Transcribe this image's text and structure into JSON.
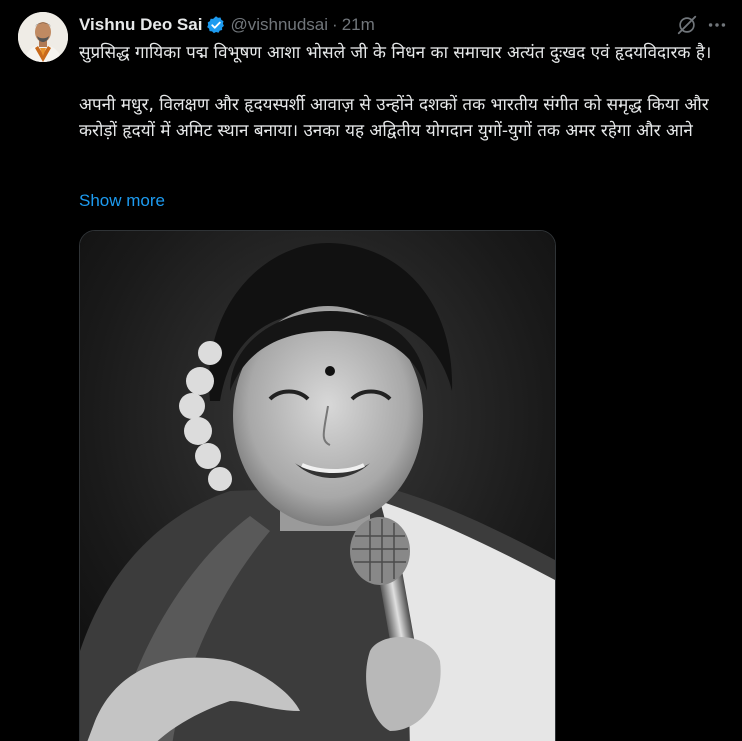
{
  "author": {
    "name": "Vishnu Deo Sai",
    "handle": "@vishnudsai",
    "separator": "·",
    "time": "21m",
    "verified": true
  },
  "tweet": {
    "paragraph1": "सुप्रसिद्ध गायिका पद्म विभूषण आशा भोसले जी के निधन का समाचार अत्यंत दुःखद एवं हृदयविदारक है।",
    "paragraph2": "अपनी मधुर, विलक्षण और हृदयस्पर्शी आवाज़ से उन्होंने दशकों तक भारतीय संगीत को समृद्ध किया और करोड़ों हृदयों में अमिट स्थान बनाया। उनका यह अद्वितीय योगदान युगों-युगों तक अमर रहेगा और आने",
    "show_more": "Show more"
  },
  "icons": {
    "verified": "verified-badge-icon",
    "grok": "grok-icon",
    "more": "more-icon"
  },
  "colors": {
    "background": "#000000",
    "text": "#e7e9ea",
    "secondary": "#71767b",
    "link": "#1d9bf0"
  }
}
